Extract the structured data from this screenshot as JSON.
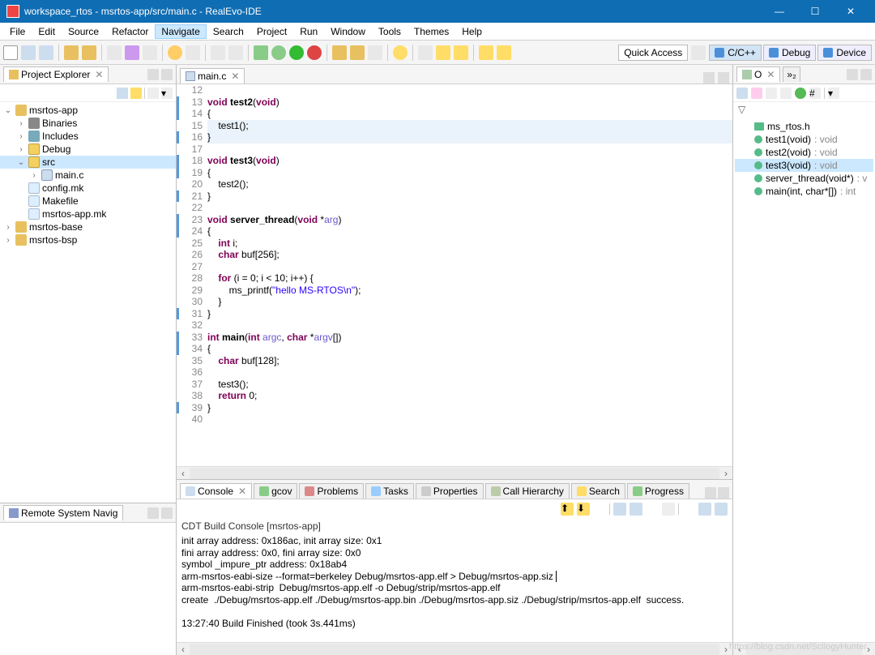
{
  "title": "workspace_rtos - msrtos-app/src/main.c - RealEvo-IDE",
  "menu": [
    "File",
    "Edit",
    "Source",
    "Refactor",
    "Navigate",
    "Search",
    "Project",
    "Run",
    "Window",
    "Tools",
    "Themes",
    "Help"
  ],
  "menu_selected": 4,
  "quick_access": "Quick Access",
  "perspectives": [
    {
      "label": "C/C++",
      "active": true
    },
    {
      "label": "Debug",
      "active": false
    },
    {
      "label": "Device",
      "active": false
    }
  ],
  "project_explorer": {
    "title": "Project Explorer",
    "tree": [
      {
        "d": 0,
        "tw": "v",
        "ic": "ic-project",
        "label": "msrtos-app"
      },
      {
        "d": 1,
        "tw": ">",
        "ic": "ic-bin",
        "label": "Binaries"
      },
      {
        "d": 1,
        "tw": ">",
        "ic": "ic-inc",
        "label": "Includes"
      },
      {
        "d": 1,
        "tw": ">",
        "ic": "ic-folder",
        "label": "Debug"
      },
      {
        "d": 1,
        "tw": "v",
        "ic": "ic-src",
        "label": "src",
        "sel": true
      },
      {
        "d": 2,
        "tw": ">",
        "ic": "ic-c",
        "label": "main.c"
      },
      {
        "d": 1,
        "tw": "",
        "ic": "ic-mk",
        "label": "config.mk"
      },
      {
        "d": 1,
        "tw": "",
        "ic": "ic-mk",
        "label": "Makefile"
      },
      {
        "d": 1,
        "tw": "",
        "ic": "ic-mk",
        "label": "msrtos-app.mk"
      },
      {
        "d": 0,
        "tw": ">",
        "ic": "ic-project",
        "label": "msrtos-base"
      },
      {
        "d": 0,
        "tw": ">",
        "ic": "ic-project",
        "label": "msrtos-bsp"
      }
    ]
  },
  "remote_view_title": "Remote System Navig",
  "editor": {
    "tab": "main.c",
    "first_line": 12,
    "lines": [
      {
        "n": 12,
        "mark": false,
        "hl": false,
        "html": ""
      },
      {
        "n": 13,
        "mark": true,
        "hl": false,
        "html": "<span class='ty'>void</span> <span class='fn'>test2</span>(<span class='ty'>void</span>)"
      },
      {
        "n": 14,
        "mark": true,
        "hl": false,
        "html": "{"
      },
      {
        "n": 15,
        "mark": false,
        "hl": true,
        "html": "    test1();"
      },
      {
        "n": 16,
        "mark": true,
        "hl": true,
        "html": "}"
      },
      {
        "n": 17,
        "mark": false,
        "hl": false,
        "html": ""
      },
      {
        "n": 18,
        "mark": true,
        "hl": false,
        "html": "<span class='ty'>void</span> <span class='fn'>test3</span>(<span class='ty'>void</span>)"
      },
      {
        "n": 19,
        "mark": true,
        "hl": false,
        "html": "{"
      },
      {
        "n": 20,
        "mark": false,
        "hl": false,
        "html": "    test2();"
      },
      {
        "n": 21,
        "mark": true,
        "hl": false,
        "html": "}"
      },
      {
        "n": 22,
        "mark": false,
        "hl": false,
        "html": ""
      },
      {
        "n": 23,
        "mark": true,
        "hl": false,
        "html": "<span class='ty'>void</span> <span class='fn'>server_thread</span>(<span class='ty'>void</span> *<span class='arg'>arg</span>)"
      },
      {
        "n": 24,
        "mark": true,
        "hl": false,
        "html": "{"
      },
      {
        "n": 25,
        "mark": false,
        "hl": false,
        "html": "    <span class='ty'>int</span> i;"
      },
      {
        "n": 26,
        "mark": false,
        "hl": false,
        "html": "    <span class='ty'>char</span> buf[<span class='num'>256</span>];"
      },
      {
        "n": 27,
        "mark": false,
        "hl": false,
        "html": ""
      },
      {
        "n": 28,
        "mark": false,
        "hl": false,
        "html": "    <span class='kw'>for</span> (i = <span class='num'>0</span>; i &lt; <span class='num'>10</span>; i++) {"
      },
      {
        "n": 29,
        "mark": false,
        "hl": false,
        "html": "        ms_printf(<span class='str'>\"hello MS-RTOS\\n\"</span>);"
      },
      {
        "n": 30,
        "mark": false,
        "hl": false,
        "html": "    }"
      },
      {
        "n": 31,
        "mark": true,
        "hl": false,
        "html": "}"
      },
      {
        "n": 32,
        "mark": false,
        "hl": false,
        "html": ""
      },
      {
        "n": 33,
        "mark": true,
        "hl": false,
        "html": "<span class='ty'>int</span> <span class='fn'>main</span>(<span class='ty'>int</span> <span class='arg'>argc</span>, <span class='ty'>char</span> *<span class='arg'>argv</span>[])"
      },
      {
        "n": 34,
        "mark": true,
        "hl": false,
        "html": "{"
      },
      {
        "n": 35,
        "mark": false,
        "hl": false,
        "html": "    <span class='ty'>char</span> buf[<span class='num'>128</span>];"
      },
      {
        "n": 36,
        "mark": false,
        "hl": false,
        "html": ""
      },
      {
        "n": 37,
        "mark": false,
        "hl": false,
        "html": "    test3();"
      },
      {
        "n": 38,
        "mark": false,
        "hl": false,
        "html": "    <span class='kw'>return</span> <span class='num'>0</span>;"
      },
      {
        "n": 39,
        "mark": true,
        "hl": false,
        "html": "}"
      },
      {
        "n": 40,
        "mark": false,
        "hl": false,
        "html": ""
      }
    ]
  },
  "outline": {
    "title": "O",
    "items": [
      {
        "ic": "inc",
        "label": "ms_rtos.h",
        "ret": ""
      },
      {
        "ic": "fn",
        "label": "test1(void)",
        "ret": " : void"
      },
      {
        "ic": "fn",
        "label": "test2(void)",
        "ret": " : void"
      },
      {
        "ic": "fn",
        "label": "test3(void)",
        "ret": " : void",
        "sel": true
      },
      {
        "ic": "fn",
        "label": "server_thread(void*)",
        "ret": " : v"
      },
      {
        "ic": "fn",
        "label": "main(int, char*[])",
        "ret": " : int"
      }
    ]
  },
  "console": {
    "tabs": [
      "Console",
      "gcov",
      "Problems",
      "Tasks",
      "Properties",
      "Call Hierarchy",
      "Search",
      "Progress"
    ],
    "active_tab": 0,
    "subtitle": "CDT Build Console [msrtos-app]",
    "lines": [
      "init array address: 0x186ac, init array size: 0x1",
      "fini array address: 0x0, fini array size: 0x0",
      "symbol _impure_ptr address: 0x18ab4",
      "arm-msrtos-eabi-size --format=berkeley Debug/msrtos-app.elf > Debug/msrtos-app.siz",
      "arm-msrtos-eabi-strip  Debug/msrtos-app.elf -o Debug/strip/msrtos-app.elf",
      "create  ./Debug/msrtos-app.elf ./Debug/msrtos-app.bin ./Debug/msrtos-app.siz ./Debug/strip/msrtos-app.elf  success.",
      "",
      "13:27:40 Build Finished (took 3s.441ms)"
    ]
  },
  "watermark": "https://blog.csdn.net/ScilogyHunter"
}
